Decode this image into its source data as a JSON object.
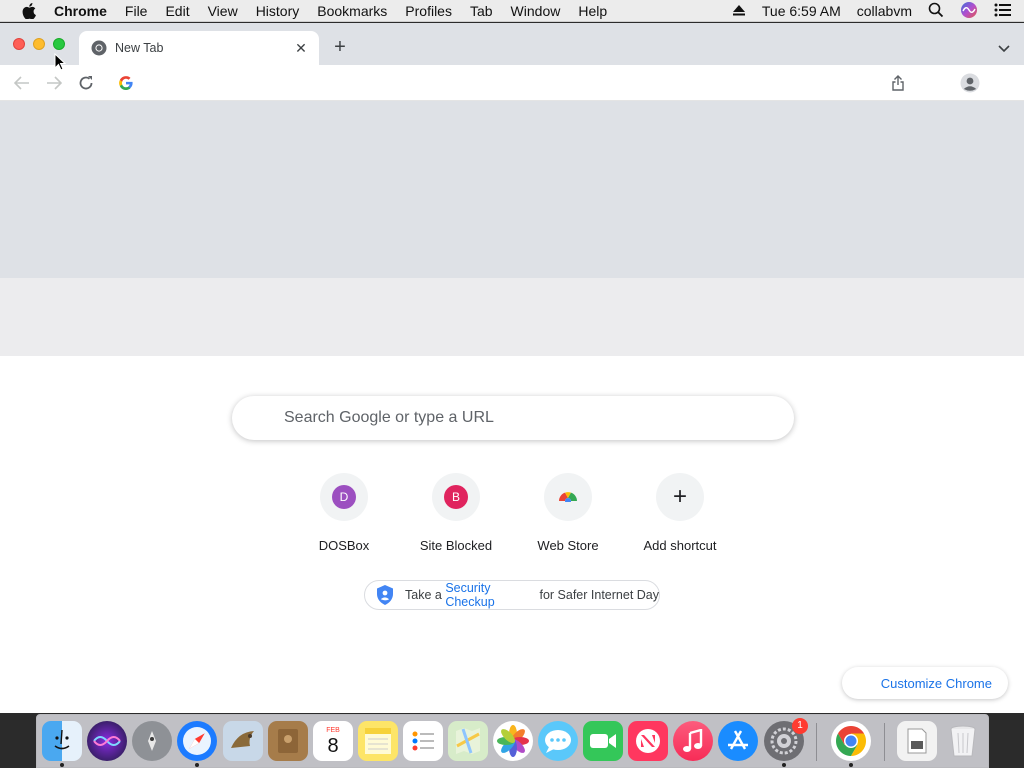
{
  "menubar": {
    "app_name": "Chrome",
    "items": [
      "File",
      "Edit",
      "View",
      "History",
      "Bookmarks",
      "Profiles",
      "Tab",
      "Window",
      "Help"
    ],
    "clock": "Tue 6:59 AM",
    "user": "collabvm"
  },
  "browser": {
    "tab_title": "New Tab",
    "tab_close": "✕",
    "new_tab": "+"
  },
  "newtab": {
    "search_placeholder": "Search Google or type a URL",
    "shortcuts": [
      {
        "label": "DOSBox",
        "initial": "D",
        "color": "#9c4fc0"
      },
      {
        "label": "Site Blocked",
        "initial": "B",
        "color": "#e0245e"
      },
      {
        "label": "Web Store",
        "initial": "",
        "color": ""
      },
      {
        "label": "Add shortcut",
        "initial": "+",
        "color": ""
      }
    ],
    "promo": {
      "prefix": "Take a ",
      "link": "Security Checkup",
      "suffix": " for Safer Internet Day"
    },
    "customize_label": "Customize Chrome"
  },
  "dock": {
    "apps": [
      "finder",
      "siri",
      "launchpad",
      "safari",
      "mail",
      "contacts",
      "calendar",
      "notes",
      "reminders",
      "maps",
      "photos",
      "messages",
      "facetime",
      "news",
      "music",
      "app-store",
      "system-preferences",
      "chrome",
      "preview",
      "trash"
    ],
    "calendar_month": "FEB",
    "calendar_day": "8",
    "system_preferences_badge": "1"
  },
  "colors": {
    "accent": "#1a73e8",
    "tabstrip": "#dee1e6"
  }
}
